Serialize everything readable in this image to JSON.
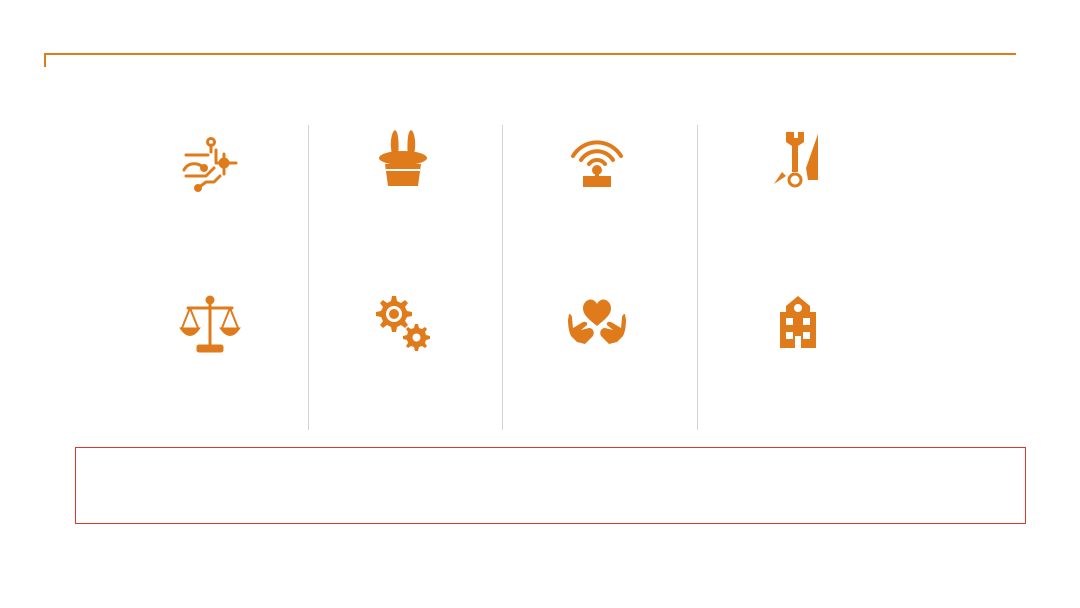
{
  "theme": {
    "accent": "#e07b1c",
    "divider": "#d4d4d4",
    "callout_border": "#d9392b"
  },
  "icons": [
    {
      "name": "circuit-icon"
    },
    {
      "name": "magic-hat-icon"
    },
    {
      "name": "wireless-joystick-icon"
    },
    {
      "name": "tools-icon"
    },
    {
      "name": "scales-of-justice-icon"
    },
    {
      "name": "gears-icon"
    },
    {
      "name": "heart-in-hands-icon"
    },
    {
      "name": "schoolhouse-icon"
    }
  ],
  "callout": {
    "text": ""
  }
}
